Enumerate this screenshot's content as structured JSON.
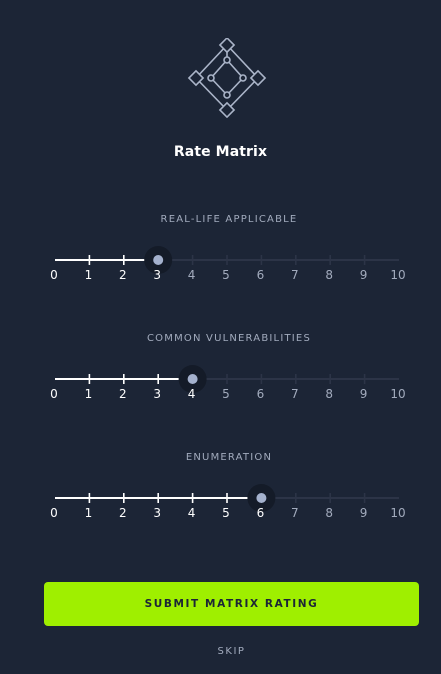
{
  "title": "Rate Matrix",
  "colors": {
    "background": "#1c2536",
    "accent": "#9fef00",
    "track_inactive": "#2c3447",
    "track_active": "#ffffff",
    "thumb": "#a4b1cd",
    "label_muted": "#a2abbd"
  },
  "icons": {
    "logo": "matrix-diamond-icon"
  },
  "scale": {
    "min": 0,
    "max": 10,
    "tick_labels": [
      "0",
      "1",
      "2",
      "3",
      "4",
      "5",
      "6",
      "7",
      "8",
      "9",
      "10"
    ]
  },
  "sliders": [
    {
      "label": "REAL-LIFE APPLICABLE",
      "value": 3
    },
    {
      "label": "COMMON VULNERABILITIES",
      "value": 4
    },
    {
      "label": "ENUMERATION",
      "value": 6
    }
  ],
  "submit_label": "SUBMIT MATRIX RATING",
  "skip_label": "SKIP"
}
